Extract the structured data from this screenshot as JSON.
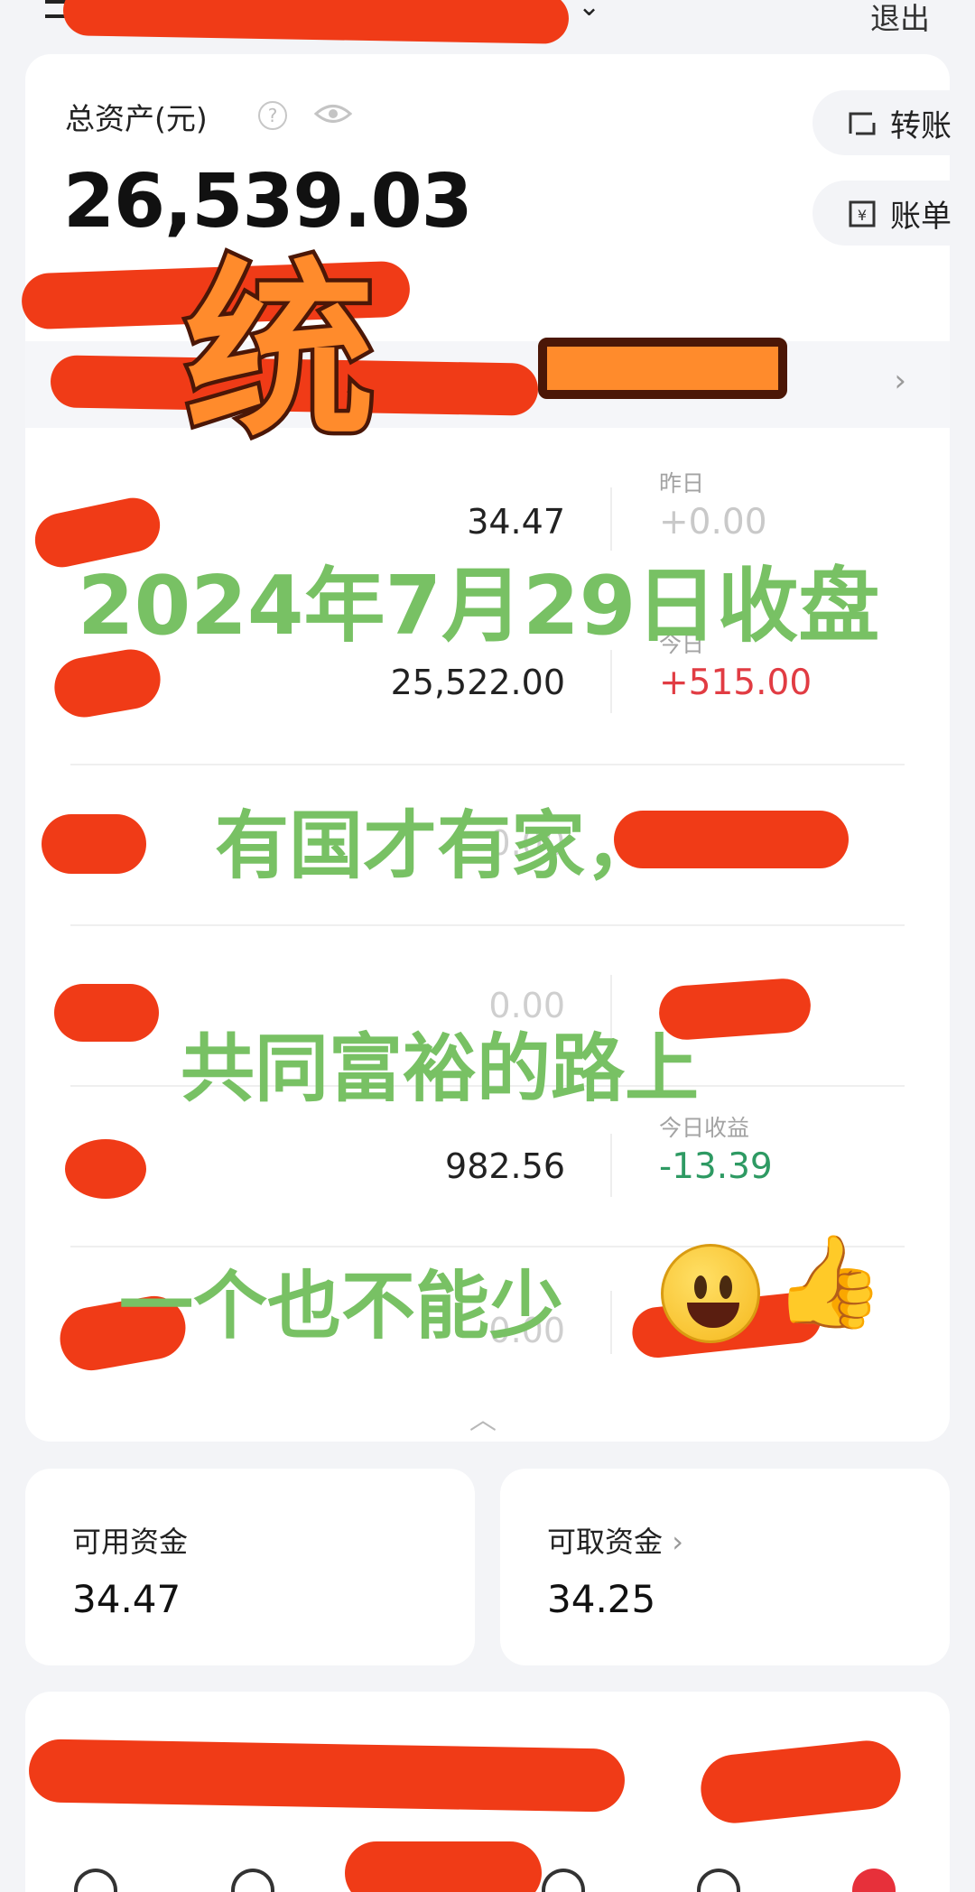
{
  "header": {
    "logout_label": "退出"
  },
  "asset": {
    "label": "总资产(元)",
    "total": "26,539.03",
    "help_icon": "help-icon",
    "eye_icon": "eye-icon"
  },
  "actions": {
    "transfer": "转账",
    "bill": "账单"
  },
  "holdings": [
    {
      "value": "34.47",
      "change_label": "昨日",
      "change": "+0.00",
      "change_color": "#c9c9c9"
    },
    {
      "value": "25,522.00",
      "change_label": "今日",
      "change": "+515.00",
      "change_color": "#e13c43"
    },
    {
      "value": "0.00",
      "change_label": "",
      "change": "",
      "change_color": "#c9c9c9"
    },
    {
      "value": "0.00",
      "change_label": "",
      "change": "",
      "change_color": "#c9c9c9"
    },
    {
      "value": "982.56",
      "change_label": "今日收益",
      "change": "-13.39",
      "change_color": "#2e9a63"
    },
    {
      "value": "0.00",
      "change_label": "",
      "change": "",
      "change_color": "#c9c9c9"
    }
  ],
  "funds": {
    "available_label": "可用资金",
    "available_value": "34.47",
    "withdrawable_label": "可取资金",
    "withdrawable_value": "34.25"
  },
  "overlay": {
    "title": "统",
    "line1": "2024年7月29日收盘",
    "line2": "有国才有家，",
    "line3": "共同富裕的路上",
    "line4": "一个也不能少",
    "emoji1": "grinning-face",
    "emoji2": "thumbs-up"
  }
}
